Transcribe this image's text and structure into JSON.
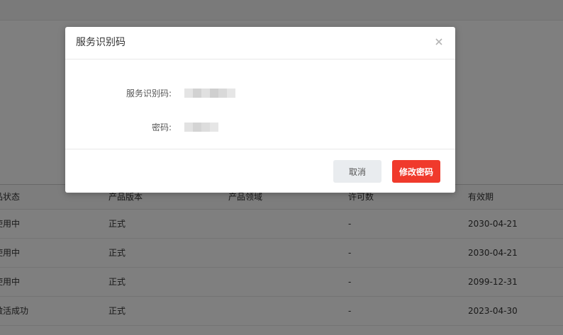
{
  "table": {
    "headers": [
      "品状态",
      "产品版本",
      "产品领域",
      "许可数",
      "有效期"
    ],
    "rows": [
      [
        "使用中",
        "正式",
        "",
        "-",
        "2030-04-21"
      ],
      [
        "使用中",
        "正式",
        "",
        "-",
        "2030-04-21"
      ],
      [
        "使用中",
        "正式",
        "",
        "-",
        "2099-12-31"
      ],
      [
        "激活成功",
        "正式",
        "",
        "-",
        "2023-04-30"
      ]
    ]
  },
  "modal": {
    "title": "服务识别码",
    "close_icon": "close-icon",
    "fields": [
      {
        "label": "服务识别码:",
        "value_masked": true
      },
      {
        "label": "密码:",
        "value_masked": true
      }
    ],
    "cancel_label": "取消",
    "primary_label": "修改密码"
  },
  "colors": {
    "primary": "#f03a2c",
    "cancel_bg": "#e9ecef",
    "overlay": "rgba(0,0,0,0.5)"
  }
}
